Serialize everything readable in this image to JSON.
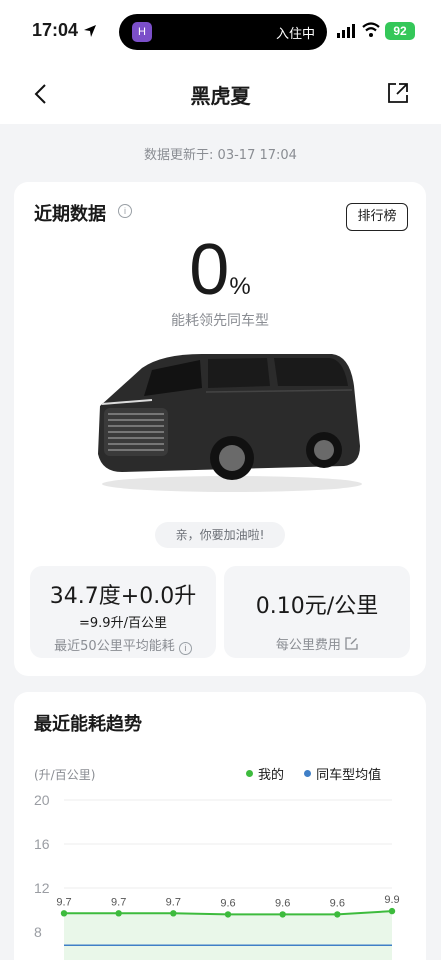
{
  "status_bar": {
    "time": "17:04",
    "island_app": "H",
    "island_text": "入住中",
    "battery": "92"
  },
  "nav": {
    "title": "黑虎夏"
  },
  "updated": "数据更新于: 03-17 17:04",
  "recent": {
    "title": "近期数据",
    "rank_button": "排行榜",
    "percent_value": "0",
    "percent_unit": "%",
    "percent_caption": "能耗领先同车型",
    "hint": "亲，你要加油啦!",
    "stat1_main": "34.7度+0.0升",
    "stat1_sub": "=9.9升/百公里",
    "stat1_caption": "最近50公里平均能耗",
    "stat2_main": "0.10元/公里",
    "stat2_caption": "每公里费用"
  },
  "trend": {
    "title": "最近能耗趋势",
    "y_unit": "(升/百公里)",
    "legend_mine": "我的",
    "legend_avg": "同车型均值"
  },
  "colors": {
    "mine": "#3dbb3d",
    "avg": "#3f7fc7",
    "accent": "#34c759"
  },
  "chart_data": {
    "type": "line",
    "y_ticks": [
      20,
      16,
      12,
      8
    ],
    "ylim": [
      4,
      20
    ],
    "series": [
      {
        "name": "我的",
        "values": [
          9.7,
          9.7,
          9.7,
          9.6,
          9.6,
          9.6,
          9.9
        ],
        "labels": [
          "9.7",
          "9.7",
          "9.7",
          "9.6",
          "9.6",
          "9.6",
          "9.9"
        ]
      },
      {
        "name": "同车型均值",
        "values": [
          6.8,
          6.8,
          6.8,
          6.8,
          6.8,
          6.8,
          6.8
        ]
      }
    ]
  }
}
